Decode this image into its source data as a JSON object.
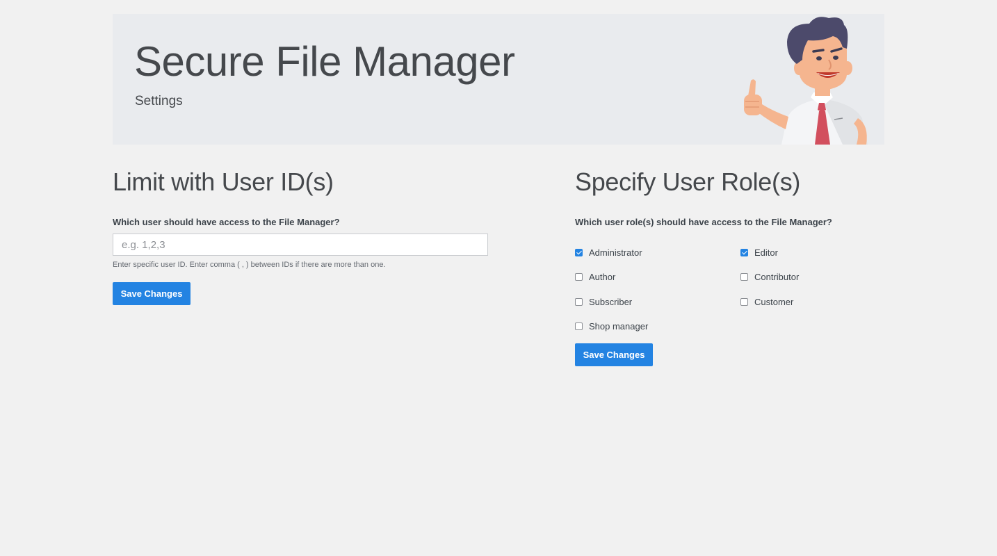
{
  "banner": {
    "title": "Secure File Manager",
    "subtitle": "Settings"
  },
  "user_ids": {
    "heading": "Limit with User ID(s)",
    "question": "Which user should have access to the File Manager?",
    "input_value": "",
    "input_placeholder": "e.g. 1,2,3",
    "help": "Enter specific user ID. Enter comma ( , ) between IDs if there are more than one.",
    "save_label": "Save Changes"
  },
  "user_roles": {
    "heading": "Specify User Role(s)",
    "question": "Which user role(s) should have access to the File Manager?",
    "roles": [
      {
        "label": "Administrator",
        "checked": true
      },
      {
        "label": "Editor",
        "checked": true
      },
      {
        "label": "Author",
        "checked": false
      },
      {
        "label": "Contributor",
        "checked": false
      },
      {
        "label": "Subscriber",
        "checked": false
      },
      {
        "label": "Customer",
        "checked": false
      },
      {
        "label": "Shop manager",
        "checked": false
      }
    ],
    "save_label": "Save Changes"
  },
  "colors": {
    "accent": "#2383e2",
    "background": "#f1f1f1",
    "banner_background": "#e9ebee",
    "text": "#3c434a"
  },
  "icons": {
    "mascot": "thumbs-up-businessman-illustration"
  }
}
